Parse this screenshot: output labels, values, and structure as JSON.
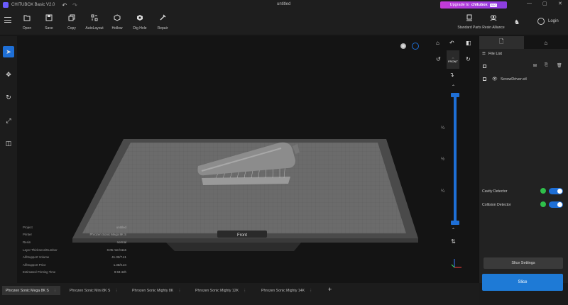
{
  "app": {
    "name": "CHITUBOX Basic V2.0",
    "document_title": "untitled",
    "upgrade": {
      "label": "Upgrade to",
      "brand": "chitubox",
      "badge": "PRO"
    }
  },
  "toolbar": {
    "items": [
      {
        "label": "Open",
        "icon": "folder-icon"
      },
      {
        "label": "Save",
        "icon": "save-icon"
      },
      {
        "label": "Copy",
        "icon": "copy-icon"
      },
      {
        "label": "AutoLayout",
        "icon": "autolayout-icon"
      },
      {
        "label": "Hollow",
        "icon": "hollow-icon"
      },
      {
        "label": "Dig Hole",
        "icon": "dig-hole-icon"
      },
      {
        "label": "Repair",
        "icon": "repair-icon"
      }
    ],
    "right_items": [
      {
        "label": "Standard Parts",
        "icon": "standard-parts-icon"
      },
      {
        "label": "Resin Alliance",
        "icon": "resin-alliance-icon"
      }
    ],
    "login": "Login"
  },
  "viewport": {
    "view_label": "FRONT",
    "slider_ticks": [
      "¾",
      "½",
      "¼"
    ],
    "bed_label": "Front"
  },
  "info_panel": {
    "rows": [
      {
        "label": "Project",
        "value": "untitled"
      },
      {
        "label": "Printer",
        "value": "Phrozen Sonic Mega 8K S"
      },
      {
        "label": "Resin",
        "value": "normal"
      },
      {
        "label": "Layer Thickness/Number",
        "value": "0.05 mm/1116"
      },
      {
        "label": "All/Support Volume",
        "value": "41.32/7.41"
      },
      {
        "label": "All/Support Price",
        "value": "1.36/0.24"
      },
      {
        "label": "Estimated Printing Time",
        "value": "9:04:42h"
      }
    ]
  },
  "right_panel": {
    "file_list_title": "File List",
    "files": [
      {
        "name": "ScrewDriver.stl"
      }
    ],
    "detectors": [
      {
        "label": "Cavity Detector",
        "enabled": true
      },
      {
        "label": "Collision Detector",
        "enabled": true
      }
    ],
    "slice_settings": "Slice Settings",
    "slice": "Slice"
  },
  "printer_tabs": [
    {
      "label": "Phrozen Sonic Mega 8K S",
      "active": true
    },
    {
      "label": "Phrozen Sonic Mini 8K S",
      "active": false
    },
    {
      "label": "Phrozen Sonic Mighty 8K",
      "active": false
    },
    {
      "label": "Phrozen Sonic Mighty 12K",
      "active": false
    },
    {
      "label": "Phrozen Sonic Mighty 14K",
      "active": false
    }
  ],
  "colors": {
    "accent": "#1e6fd6",
    "detector_ok": "#2fbf4a",
    "upgrade_gradient_start": "#c43bd8",
    "upgrade_gradient_end": "#8a3ee0"
  }
}
